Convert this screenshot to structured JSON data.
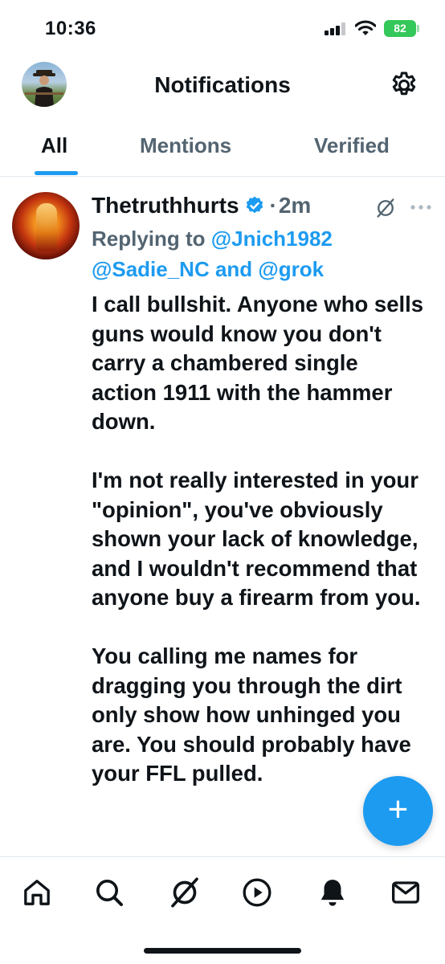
{
  "status_bar": {
    "time": "10:36",
    "battery": "82"
  },
  "header": {
    "title": "Notifications",
    "avatar_icon": "profile-avatar",
    "settings_icon": "gear-icon"
  },
  "tabs": [
    {
      "label": "All",
      "active": true
    },
    {
      "label": "Mentions",
      "active": false
    },
    {
      "label": "Verified",
      "active": false
    }
  ],
  "post": {
    "author": "Thetruthhurts",
    "separator": "·",
    "time": "2m",
    "replying_prefix": "Replying to ",
    "reply_to_1": "@Jnich1982",
    "reply_to_2": "@Sadie_NC",
    "reply_and": " and ",
    "reply_to_3": "@grok",
    "body": "I call bullshit.  Anyone who sells guns would know you don't carry a chambered single action 1911 with the hammer down.\n\nI'm not really interested in your \"opinion\", you've obviously shown your lack of knowledge, and I  wouldn't recommend that anyone buy a firearm from you.\n\nYou calling me names for dragging you through the dirt only show how unhinged you are.  You should probably have your FFL pulled."
  },
  "fab": {
    "label": "+"
  },
  "bottom_nav": [
    {
      "icon": "home-icon"
    },
    {
      "icon": "search-icon"
    },
    {
      "icon": "grok-icon"
    },
    {
      "icon": "video-play-icon"
    },
    {
      "icon": "notifications-bell-icon"
    },
    {
      "icon": "mail-icon"
    }
  ],
  "colors": {
    "accent": "#1d9bf0",
    "text": "#0f1419",
    "muted": "#536471",
    "battery": "#34c759"
  }
}
